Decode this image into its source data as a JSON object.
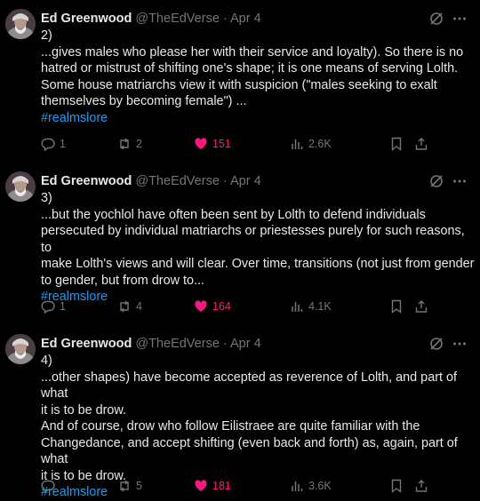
{
  "tweets": [
    {
      "author": "Ed Greenwood",
      "handle": "@TheEdVerse",
      "dot": "·",
      "date": "Apr 4",
      "number": "2)",
      "lines": [
        "...gives males who please her with their service and loyalty). So there is no",
        "hatred or mistrust of shifting one's shape; it is one means of serving Lolth.",
        "Some house matriarchs view it with suspicion (\"males seeking to exalt",
        "themselves by becoming female\") ..."
      ],
      "hashtag": "#realmslore",
      "replies": "1",
      "reposts": "2",
      "likes": "151",
      "views": "2.6K"
    },
    {
      "author": "Ed Greenwood",
      "handle": "@TheEdVerse",
      "dot": "·",
      "date": "Apr 4",
      "number": "3)",
      "lines": [
        "...but the yochlol have often been sent by Lolth to defend individuals",
        "persecuted by individual matriarchs or priestesses purely for such reasons, to",
        "make Lolth's views and will clear. Over time, transitions (not just from gender",
        "to gender, but from drow to..."
      ],
      "hashtag": "#realmslore",
      "replies": "1",
      "reposts": "4",
      "likes": "164",
      "views": "4.1K"
    },
    {
      "author": "Ed Greenwood",
      "handle": "@TheEdVerse",
      "dot": "·",
      "date": "Apr 4",
      "number": "4)",
      "lines": [
        "...other shapes) have become accepted as reverence of Lolth, and part of what",
        "it is to be drow.",
        "And of course, drow who follow Eilistraee are quite familiar with the",
        "Changedance, and accept shifting (even back and forth) as, again, part of what",
        "it is to be drow."
      ],
      "hashtag": "#realmslore",
      "replies": "",
      "reposts": "5",
      "likes": "181",
      "views": "3.6K"
    }
  ],
  "colors": {
    "background": "#000000",
    "text": "#e7e9ea",
    "muted": "#71767b",
    "link": "#1d9bf0",
    "like": "#f91880"
  },
  "icons": [
    "avatar",
    "grok-icon",
    "more-icon",
    "reply-icon",
    "repost-icon",
    "like-icon",
    "views-icon",
    "bookmark-icon",
    "share-icon"
  ]
}
